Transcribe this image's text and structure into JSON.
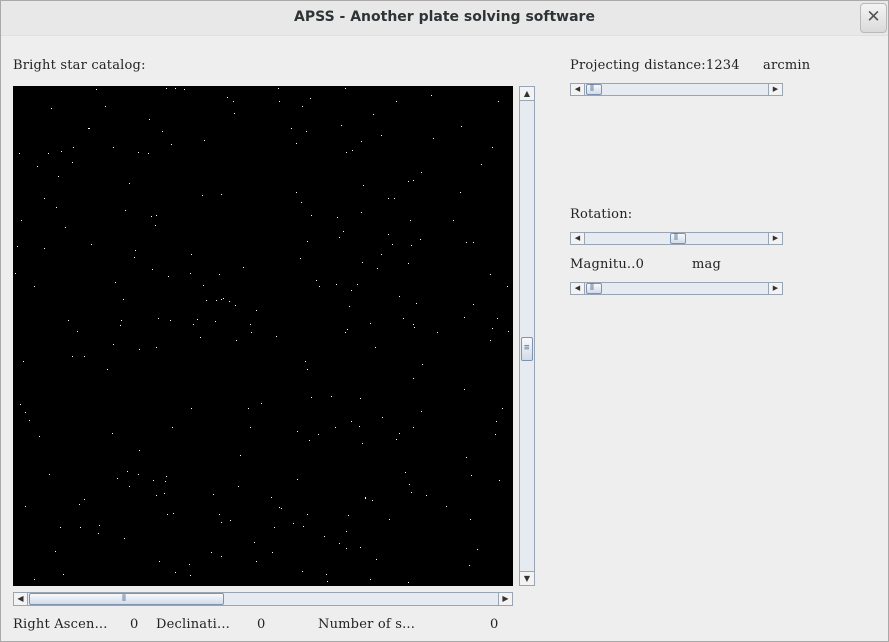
{
  "window": {
    "title": "APSS - Another plate solving software",
    "close_symbol": "✕"
  },
  "catalog": {
    "label": "Bright star catalog:"
  },
  "controls": {
    "projecting_distance": {
      "label": "Projecting distance:",
      "value": "1234",
      "unit": "arcmin",
      "slider_fraction": 0.05
    },
    "rotation": {
      "label": "Rotation:",
      "slider_fraction": 0.5
    },
    "magnitude": {
      "label": "Magnitu..",
      "value": "0",
      "unit": "mag",
      "slider_fraction": 0.05
    }
  },
  "scroll": {
    "vertical_fraction": 0.5,
    "horizontal_thumb_fraction": 0.4
  },
  "status": {
    "ra_label": "Right Ascen...",
    "ra_value": "0",
    "dec_label": "Declinati...",
    "dec_value": "0",
    "count_label": "Number of s...",
    "count_value": "0"
  },
  "icons": {
    "up": "arrow-up-icon",
    "down": "arrow-down-icon",
    "left": "arrow-left-icon",
    "right": "arrow-right-icon",
    "grip": "grip-icon"
  }
}
